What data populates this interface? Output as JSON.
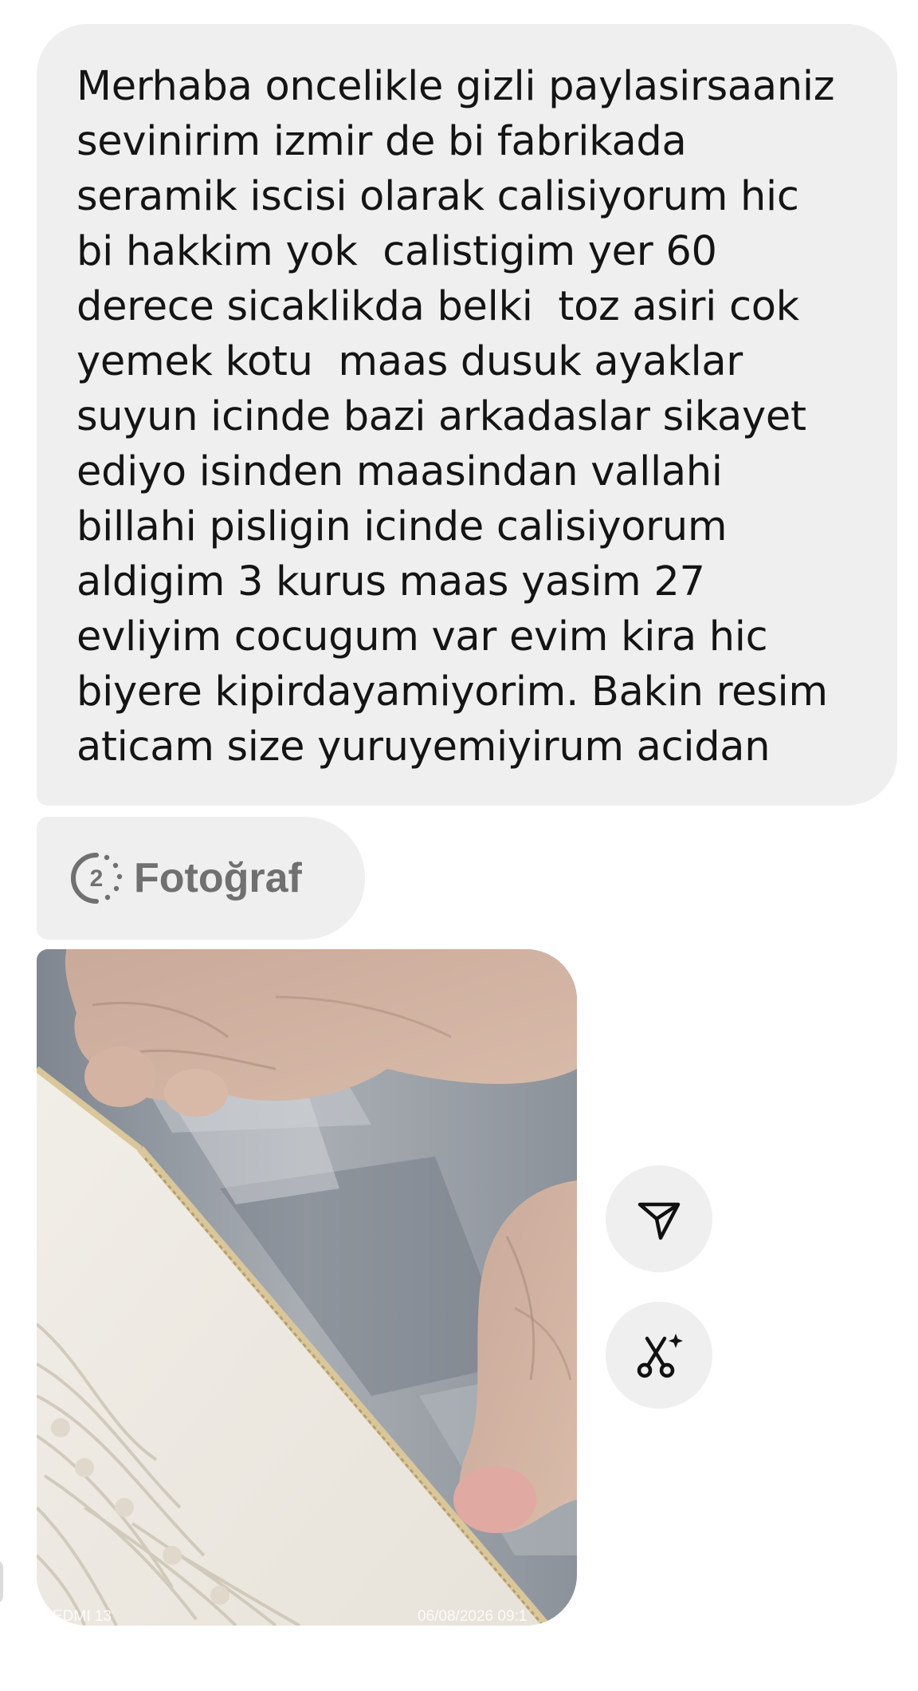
{
  "message": {
    "lines": [
      "Merhaba oncelikle gizli paylasirsaaniz",
      "sevinirim izmir de bi fabrikada",
      "seramik iscisi olarak calisiyorum hic",
      "bi hakkim yok  calistigim yer 60",
      "derece sicaklikda belki  toz asiri cok",
      "yemek kotu  maas dusuk ayaklar",
      "suyun icinde bazi arkadaslar sikayet",
      "ediyo isinden maasindan vallahi",
      "billahi pisligin icinde calisiyorum",
      "aldigim 3 kurus maas yasim 27",
      "evliyim cocugum var evim kira hic",
      "biyere kipirdayamiyorim. Bakin resim",
      "aticam size yuruyemiyirum acidan"
    ]
  },
  "photo_chip": {
    "count": "2",
    "label": "Fotoğraf",
    "icon": "view-once-icon"
  },
  "photo": {
    "subject": "feet on rug",
    "caption_left": "EDMI 13",
    "caption_right": "06/08/2026 09:1"
  },
  "actions": [
    {
      "icon": "paper-plane-icon"
    },
    {
      "icon": "scissors-sparkle-icon"
    }
  ],
  "colors": {
    "bubble": "#efefef",
    "text": "#141414",
    "chip_text": "#707070"
  }
}
